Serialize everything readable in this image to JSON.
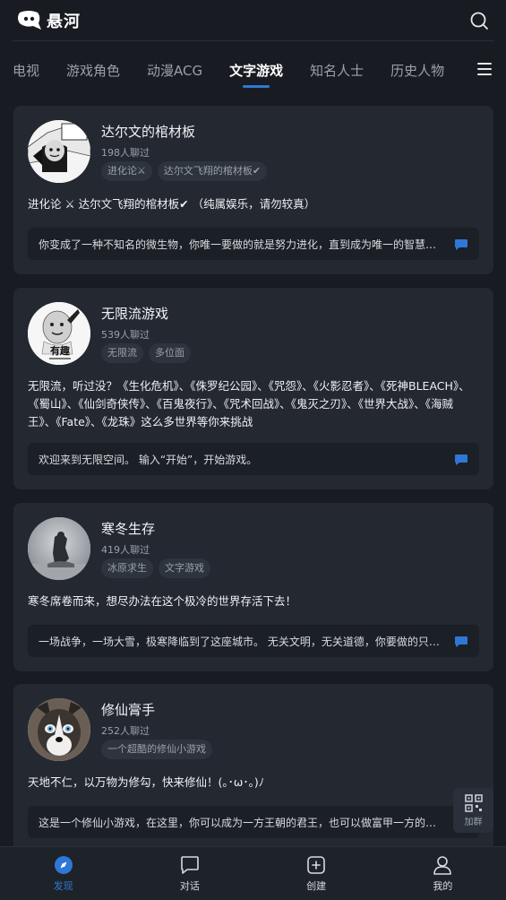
{
  "app": {
    "name": "悬河"
  },
  "tabs": [
    {
      "label": "电视"
    },
    {
      "label": "游戏角色"
    },
    {
      "label": "动漫ACG"
    },
    {
      "label": "文字游戏",
      "active": true
    },
    {
      "label": "知名人士"
    },
    {
      "label": "历史人物"
    }
  ],
  "cards": [
    {
      "title": "达尔文的棺材板",
      "count": "198人聊过",
      "tags": [
        "进化论⚔",
        "达尔文飞翔的棺材板✔"
      ],
      "desc": "进化论 ⚔ 达尔文飞翔的棺材板✔ （纯属娱乐，请勿较真）",
      "message": "你变成了一种不知名的微生物，你唯一要做的就是努力进化，直到成为唯一的智慧物种"
    },
    {
      "title": "无限流游戏",
      "count": "539人聊过",
      "tags": [
        "无限流",
        "多位面"
      ],
      "avatar_caption": "有趣",
      "desc": "无限流，听过没？《生化危机》、《侏罗纪公园》、《咒怨》、《火影忍者》、《死神BLEACH》、《蜀山》、《仙剑奇侠传》、《百鬼夜行》、《咒术回战》、《鬼灭之刃》、《世界大战》、《海贼王》、《Fate》、《龙珠》这么多世界等你来挑战",
      "message": "欢迎来到无限空间。 输入“开始”，开始游戏。"
    },
    {
      "title": "寒冬生存",
      "count": "419人聊过",
      "tags": [
        "冰原求生",
        "文字游戏"
      ],
      "desc": "寒冬席卷而来，想尽办法在这个极冷的世界存活下去！",
      "message": "一场战争，一场大雪，极寒降临到了这座城市。 无关文明，无关道德，你要做的只有活下去"
    },
    {
      "title": "修仙膏手",
      "count": "252人聊过",
      "tags": [
        "一个超酷的修仙小游戏"
      ],
      "desc": "天地不仁，以万物为修勾，快来修仙！(｡･ω･｡)ﾉ",
      "message": "这是一个修仙小游戏，在这里，你可以成为一方王朝的君王，也可以做富甲一方的商人"
    }
  ],
  "join_group": {
    "label": "加群"
  },
  "bottom_nav": [
    {
      "label": "发现",
      "icon": "compass-icon",
      "active": true
    },
    {
      "label": "对话",
      "icon": "chat-bubble-icon"
    },
    {
      "label": "创建",
      "icon": "plus-square-icon"
    },
    {
      "label": "我的",
      "icon": "person-icon"
    }
  ],
  "colors": {
    "accent": "#2f77d6",
    "background": "#181b21",
    "card": "#232831"
  }
}
